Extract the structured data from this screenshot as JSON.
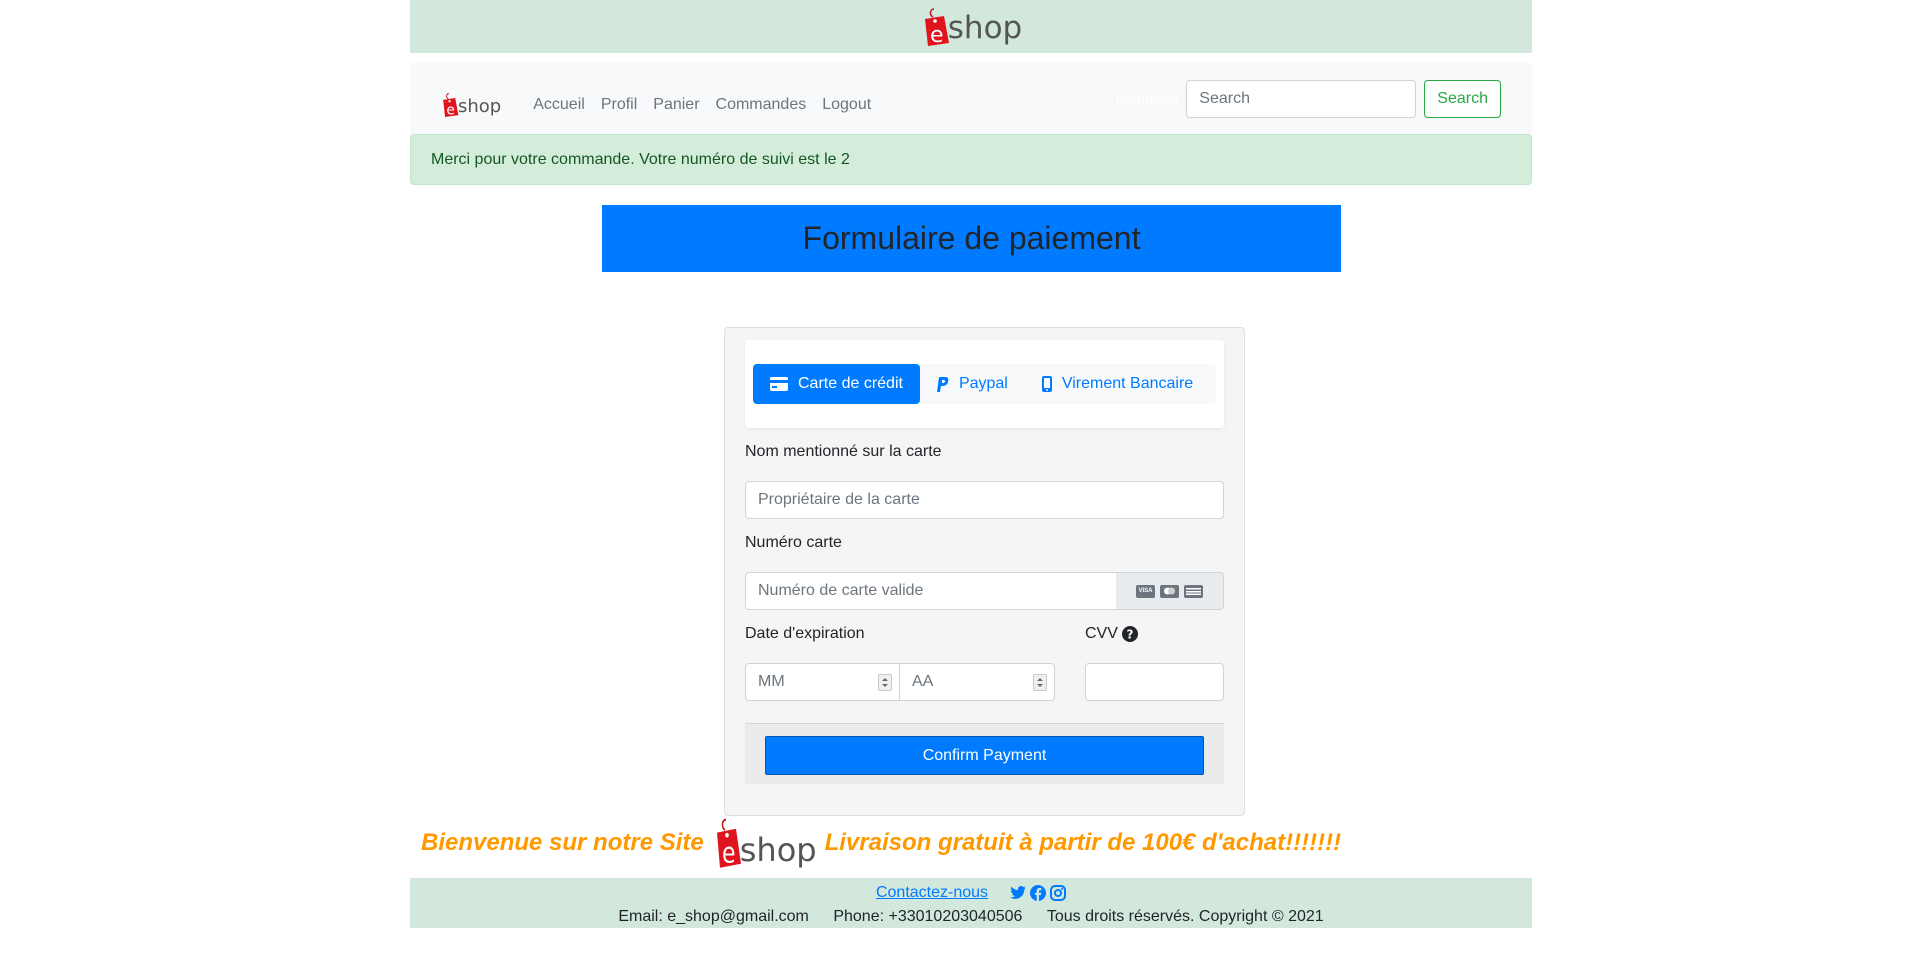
{
  "brand": {
    "logo_letter": "e",
    "logo_text": "shop"
  },
  "nav": {
    "links": [
      "Accueil",
      "Profil",
      "Panier",
      "Commandes",
      "Logout"
    ],
    "username": "mandona",
    "search_placeholder": "Search",
    "search_button": "Search"
  },
  "alert": {
    "message": "Merci pour votre commande. Votre numéro de suivi est le 2"
  },
  "page": {
    "title": "Formulaire de paiement"
  },
  "payment": {
    "tabs": [
      {
        "label": "Carte de crédit",
        "icon": "credit-card-icon",
        "active": true
      },
      {
        "label": "Paypal",
        "icon": "paypal-icon",
        "active": false
      },
      {
        "label": "Virement Bancaire",
        "icon": "mobile-icon",
        "active": false
      }
    ],
    "name_label": "Nom mentionné sur la carte",
    "name_placeholder": "Propriétaire de la carte",
    "number_label": "Numéro carte",
    "number_placeholder": "Numéro de carte valide",
    "card_brands": [
      "VISA",
      "mastercard-icon",
      "amex-icon"
    ],
    "expiry_label": "Date d'expiration",
    "month_placeholder": "MM",
    "year_placeholder": "AA",
    "cvv_label": "CVV",
    "confirm_button": "Confirm Payment"
  },
  "welcome": {
    "left": "Bienvenue sur notre Site",
    "right": "Livraison gratuit à partir de 100€ d'achat!!!!!!!"
  },
  "footer": {
    "contact": "Contactez-nous",
    "email": "Email: e_shop@gmail.com",
    "phone": "Phone: +33010203040506",
    "copyright": "Tous droits réservés. Copyright © 2021"
  },
  "colors": {
    "primary": "#007bff",
    "success": "#28a745",
    "banner_bg": "#d3e8dc",
    "alert_bg": "#d4edda",
    "welcome_text": "#ff9900",
    "logo_red": "#e0141e"
  }
}
